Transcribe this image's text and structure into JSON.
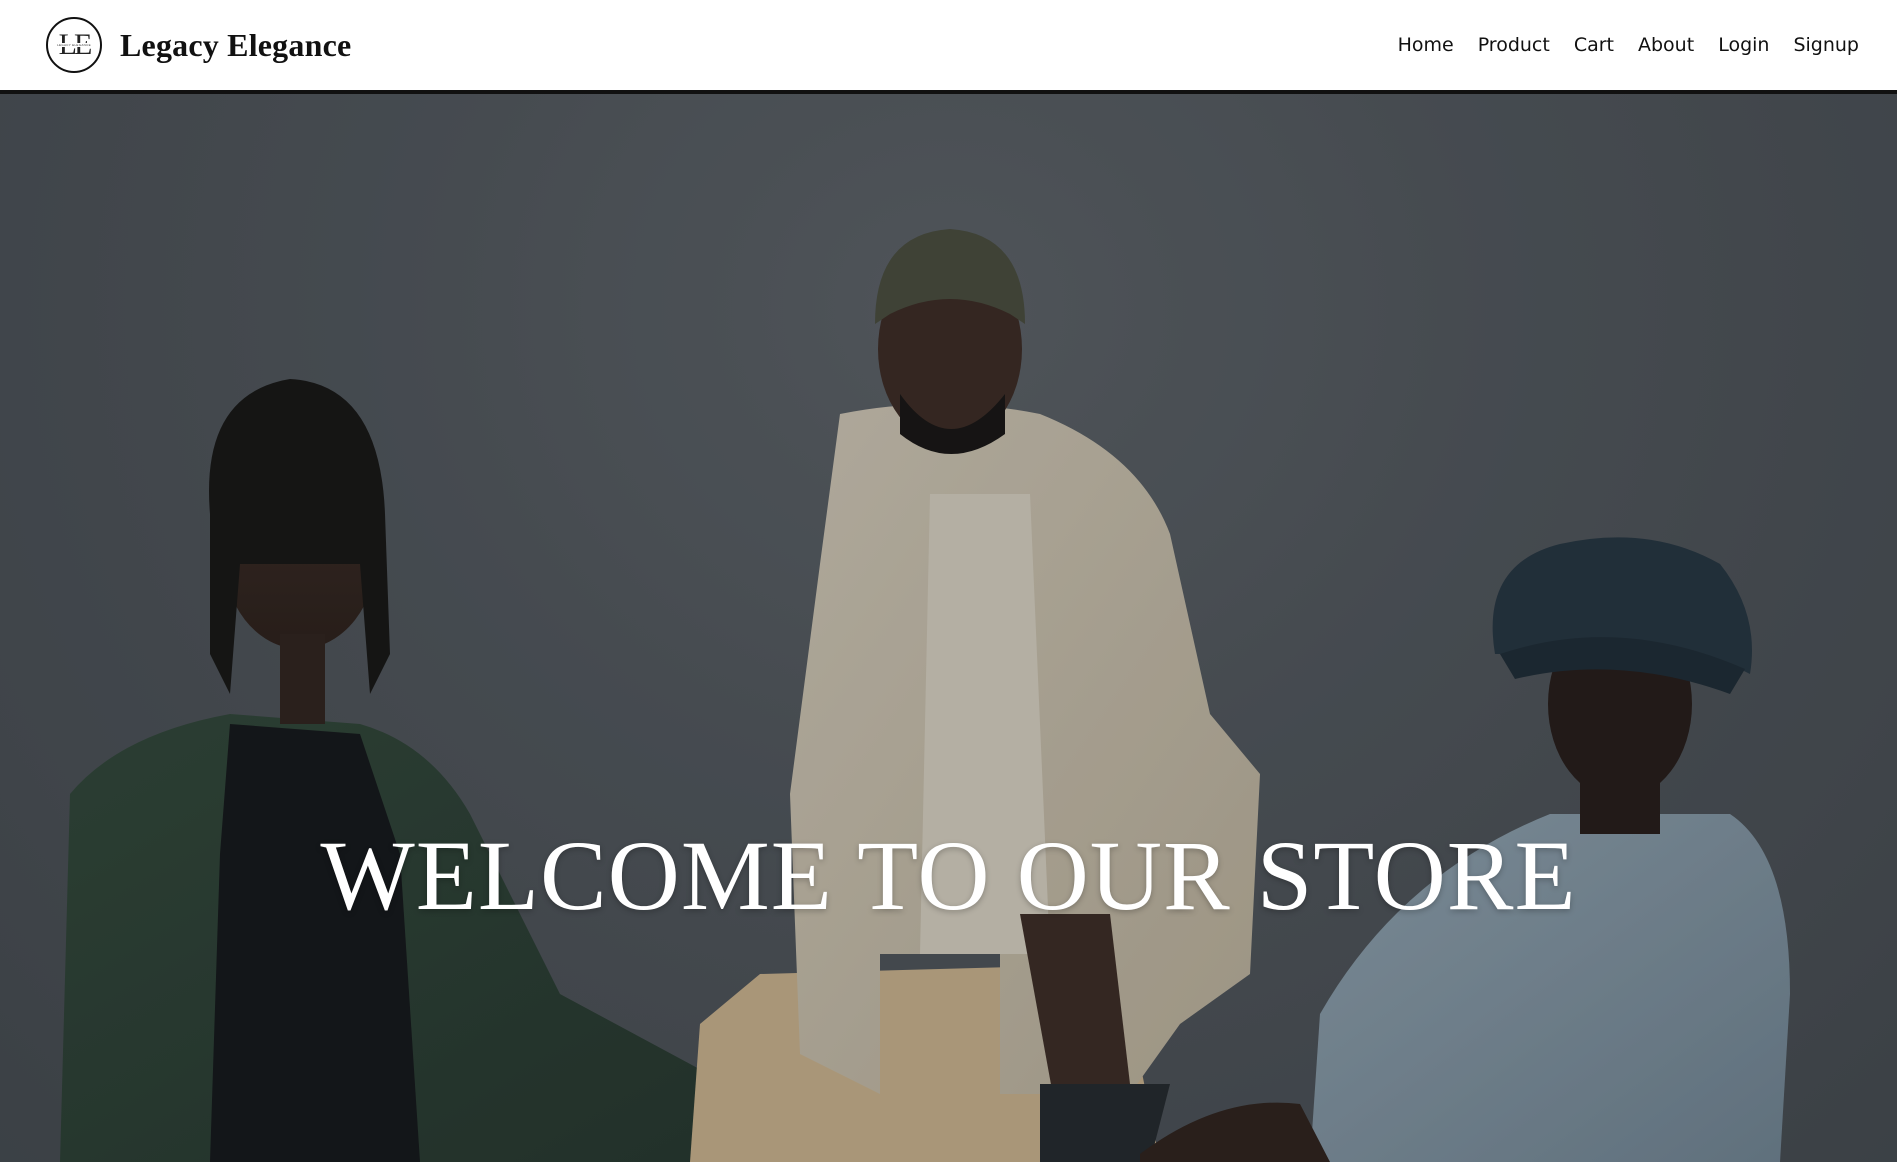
{
  "brand": {
    "logo_mono": "LE",
    "logo_small": "LEGACY ELEGANCE",
    "name": "Legacy Elegance"
  },
  "nav": {
    "items": [
      {
        "label": "Home"
      },
      {
        "label": "Product"
      },
      {
        "label": "Cart"
      },
      {
        "label": "About"
      },
      {
        "label": "Login"
      },
      {
        "label": "Signup"
      }
    ]
  },
  "hero": {
    "title": "WELCOME TO OUR STORE",
    "image": "photo-three-models",
    "colors": {
      "background": "#4e5358",
      "text": "#ffffff"
    }
  }
}
